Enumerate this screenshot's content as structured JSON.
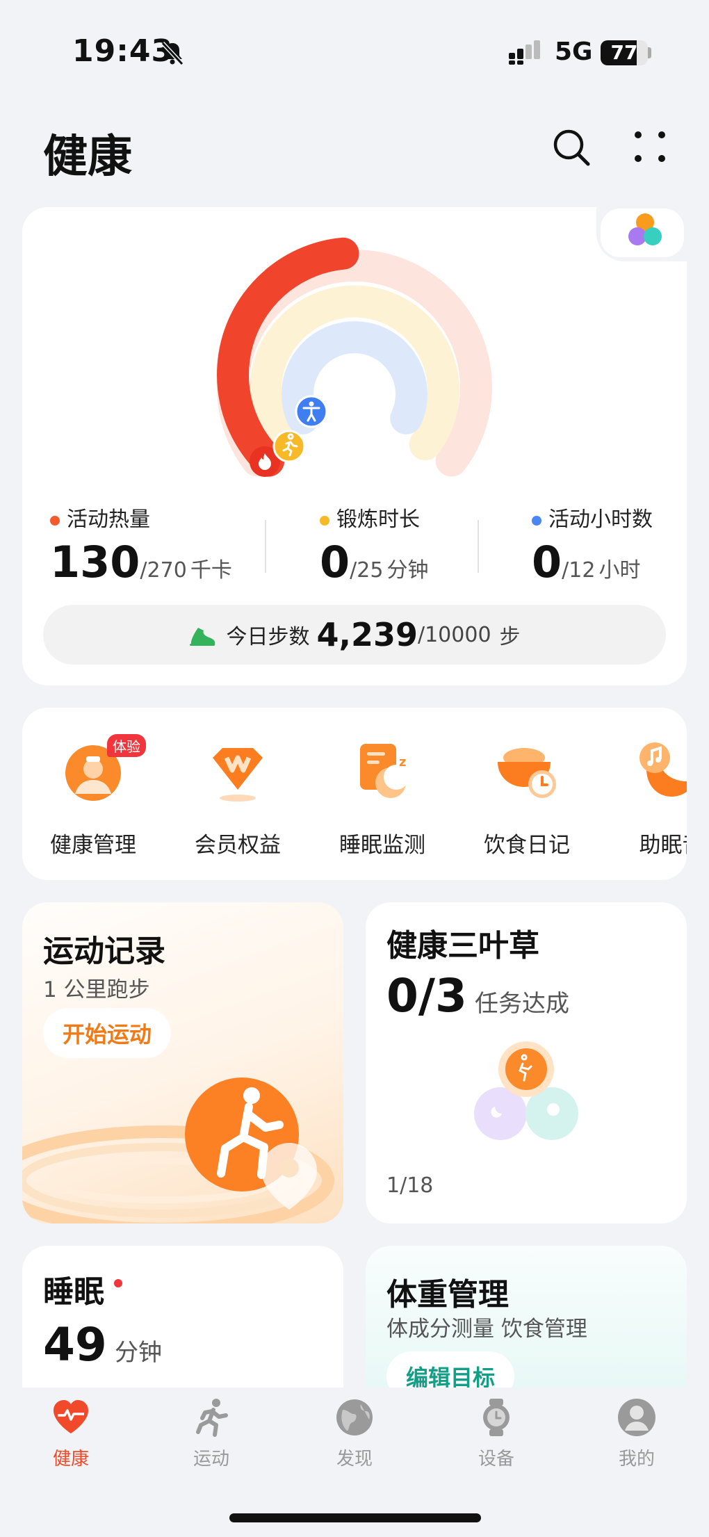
{
  "status_bar": {
    "time": "19:43",
    "network": "5G",
    "battery": "77",
    "battery_level": 0.77
  },
  "header": {
    "title": "健康"
  },
  "activity": {
    "rings": {
      "calories_fraction": 0.48,
      "exercise_fraction": 0.0,
      "stand_fraction": 0.0
    },
    "calories": {
      "label": "活动热量",
      "value": "130",
      "goal": "/270",
      "unit": "千卡",
      "color": "#f35a2c"
    },
    "exercise": {
      "label": "锻炼时长",
      "value": "0",
      "goal": "/25",
      "unit": "分钟",
      "color": "#f7b928"
    },
    "stand": {
      "label": "活动小时数",
      "value": "0",
      "goal": "/12",
      "unit": "小时",
      "color": "#4a86f5"
    },
    "steps": {
      "label": "今日步数",
      "value": "4,239",
      "goal": "/10000",
      "unit": "步"
    }
  },
  "quick_entries": [
    {
      "label": "健康管理",
      "icon": "doctor-icon",
      "badge": "体验"
    },
    {
      "label": "会员权益",
      "icon": "vip-diamond-icon"
    },
    {
      "label": "睡眠监测",
      "icon": "sleep-monitor-icon"
    },
    {
      "label": "饮食日记",
      "icon": "diet-bowl-icon"
    },
    {
      "label": "助眠音",
      "icon": "music-note-icon"
    }
  ],
  "workout_card": {
    "title": "运动记录",
    "subtitle": "1 公里跑步",
    "button": "开始运动"
  },
  "clover_card": {
    "title": "健康三叶草",
    "value": "0/3",
    "value_label": "任务达成",
    "footer": "1/18"
  },
  "sleep_card": {
    "title": "睡眠",
    "value": "49",
    "unit": "分钟"
  },
  "weight_card": {
    "title": "体重管理",
    "subtitle": "体成分测量 饮食管理",
    "button": "编辑目标"
  },
  "tab_bar": [
    {
      "label": "健康",
      "icon": "heart-icon",
      "active": true
    },
    {
      "label": "运动",
      "icon": "runner-icon"
    },
    {
      "label": "发现",
      "icon": "globe-icon"
    },
    {
      "label": "设备",
      "icon": "watch-icon"
    },
    {
      "label": "我的",
      "icon": "profile-icon"
    }
  ]
}
